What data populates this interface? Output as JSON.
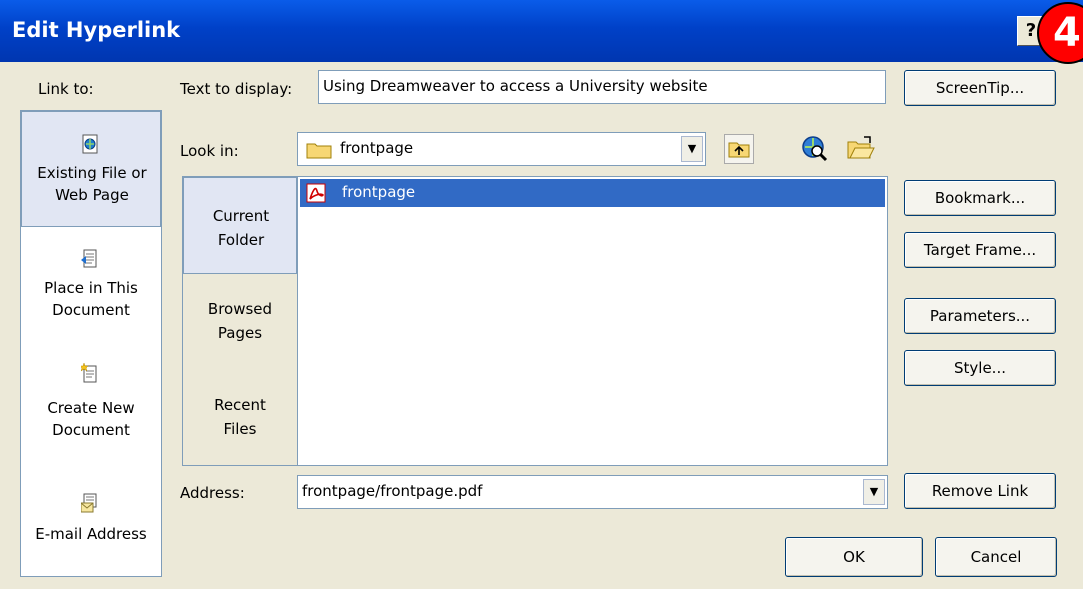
{
  "window": {
    "title": "Edit Hyperlink",
    "help": "?",
    "annotation_badge": "4"
  },
  "link_to": {
    "label": "Link to:",
    "items": [
      {
        "label_line1": "Existing File or",
        "label_line2": "Web Page",
        "icon": "web-page-icon",
        "selected": true
      },
      {
        "label_line1": "Place in This",
        "label_line2": "Document",
        "icon": "place-in-document-icon",
        "selected": false
      },
      {
        "label_line1": "Create New",
        "label_line2": "Document",
        "icon": "new-document-icon",
        "selected": false
      },
      {
        "label_line1": "E-mail Address",
        "label_line2": "",
        "icon": "email-icon",
        "selected": false
      }
    ]
  },
  "text_to_display": {
    "label": "Text to display:",
    "value": "Using Dreamweaver to access a University website"
  },
  "look_in": {
    "label": "Look in:",
    "value": "frontpage"
  },
  "nav": {
    "items": [
      {
        "line1": "Current",
        "line2": "Folder",
        "selected": true
      },
      {
        "line1": "Browsed",
        "line2": "Pages",
        "selected": false
      },
      {
        "line1": "Recent",
        "line2": "Files",
        "selected": false
      }
    ]
  },
  "files": [
    {
      "name": "frontpage",
      "icon": "pdf-file-icon",
      "selected": true
    }
  ],
  "address": {
    "label": "Address:",
    "value": "frontpage/frontpage.pdf"
  },
  "buttons": {
    "screentip": "ScreenTip...",
    "bookmark": "Bookmark...",
    "target_frame": "Target Frame...",
    "parameters": "Parameters...",
    "style": "Style...",
    "remove_link": "Remove Link",
    "ok": "OK",
    "cancel": "Cancel"
  },
  "colors": {
    "titlebar": "#0041c8",
    "selection": "#316ac5",
    "dialog_bg": "#ece9d8",
    "badge": "#ff0000"
  }
}
